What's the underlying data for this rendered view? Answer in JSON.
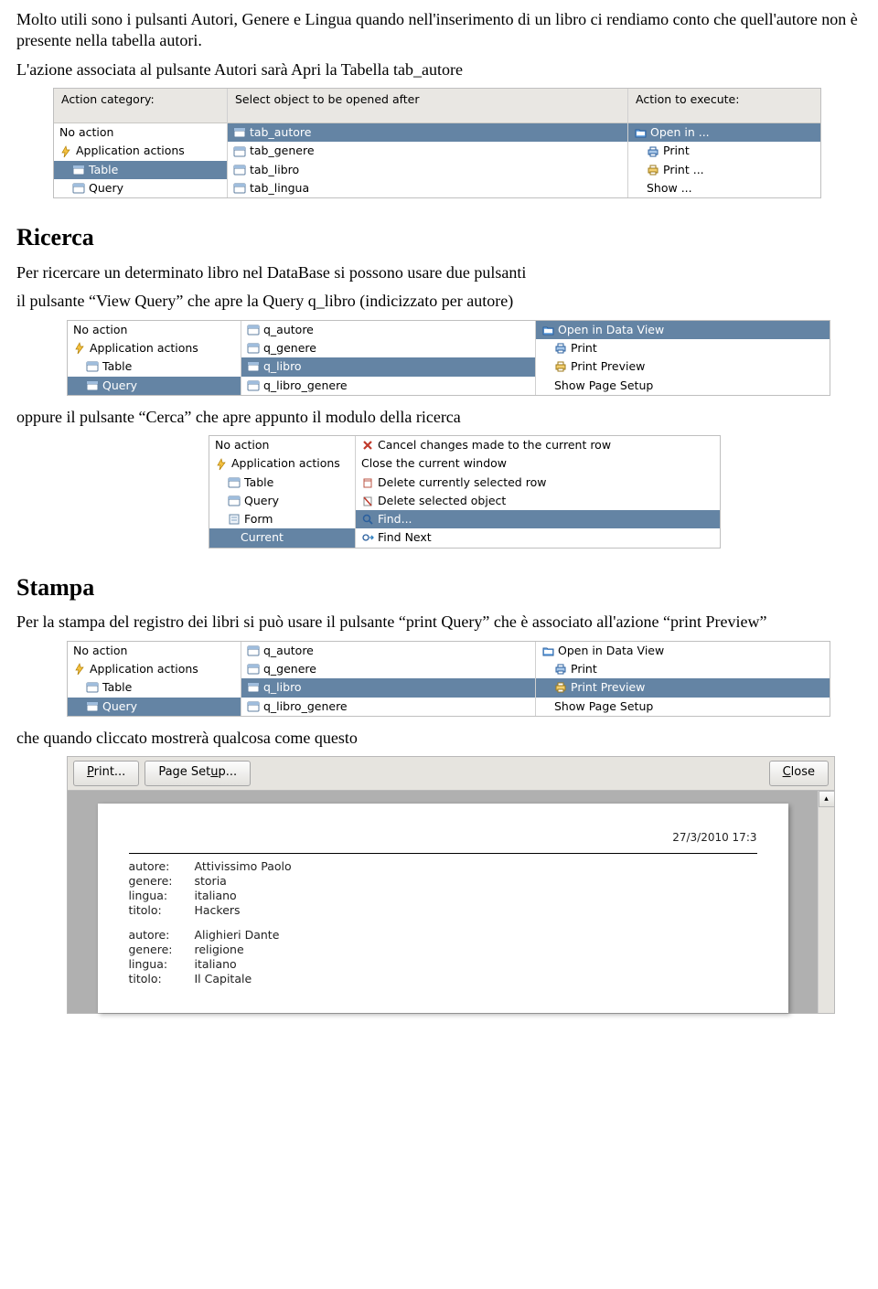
{
  "intro": {
    "p1": "Molto utili sono i pulsanti Autori, Genere e Lingua quando nell'inserimento di un libro ci rendiamo conto che quell'autore non è presente nella tabella autori.",
    "p2": "L'azione associata al pulsante Autori sarà Apri la Tabella tab_autore"
  },
  "panel1": {
    "headers": {
      "col1": "Action category:",
      "col2": "Select object to be opened after",
      "col3": "Action to execute:"
    },
    "col1": [
      {
        "label": "No action",
        "icon": "",
        "sel": false
      },
      {
        "label": "Application actions",
        "icon": "lightning",
        "sel": false
      },
      {
        "label": "Table",
        "icon": "table",
        "sel": true,
        "indent": true
      },
      {
        "label": "Query",
        "icon": "table",
        "sel": false,
        "indent": true
      }
    ],
    "col2": [
      {
        "label": "tab_autore",
        "icon": "table",
        "sel": true
      },
      {
        "label": "tab_genere",
        "icon": "table",
        "sel": false
      },
      {
        "label": "tab_libro",
        "icon": "table",
        "sel": false
      },
      {
        "label": "tab_lingua",
        "icon": "table",
        "sel": false
      }
    ],
    "col3": [
      {
        "label": "Open in ...",
        "icon": "folder",
        "sel": true
      },
      {
        "label": "Print",
        "icon": "printer",
        "sel": false,
        "indent": true
      },
      {
        "label": "Print ...",
        "icon": "printer-y",
        "sel": false,
        "indent": true
      },
      {
        "label": "Show ...",
        "icon": "",
        "sel": false,
        "indent": true
      }
    ]
  },
  "ricerca": {
    "heading": "Ricerca",
    "p1": "Per ricercare un determinato libro nel DataBase si possono usare due pulsanti",
    "p2": "il pulsante “View Query” che apre la Query q_libro (indicizzato per autore)",
    "p3": "oppure il pulsante “Cerca” che apre appunto il modulo della ricerca"
  },
  "panel2": {
    "col1": [
      {
        "label": "No action",
        "icon": "",
        "sel": false
      },
      {
        "label": "Application actions",
        "icon": "lightning",
        "sel": false
      },
      {
        "label": "Table",
        "icon": "table",
        "sel": false,
        "indent": true
      },
      {
        "label": "Query",
        "icon": "table",
        "sel": true,
        "indent": true
      }
    ],
    "col2": [
      {
        "label": "q_autore",
        "icon": "table",
        "sel": false
      },
      {
        "label": "q_genere",
        "icon": "table",
        "sel": false
      },
      {
        "label": "q_libro",
        "icon": "table",
        "sel": true
      },
      {
        "label": "q_libro_genere",
        "icon": "table",
        "sel": false
      }
    ],
    "col3": [
      {
        "label": "Open in Data View",
        "icon": "folder",
        "sel": true
      },
      {
        "label": "Print",
        "icon": "printer",
        "sel": false,
        "indent": true
      },
      {
        "label": "Print Preview",
        "icon": "printer-y",
        "sel": false,
        "indent": true
      },
      {
        "label": "Show Page Setup",
        "icon": "",
        "sel": false,
        "indent": true
      }
    ]
  },
  "panel3": {
    "col1": [
      {
        "label": "No action",
        "icon": "",
        "sel": false
      },
      {
        "label": "Application actions",
        "icon": "lightning",
        "sel": false
      },
      {
        "label": "Table",
        "icon": "table",
        "sel": false,
        "indent": true
      },
      {
        "label": "Query",
        "icon": "table",
        "sel": false,
        "indent": true
      },
      {
        "label": "Form",
        "icon": "form",
        "sel": false,
        "indent": true
      },
      {
        "label": "Current",
        "icon": "",
        "sel": true,
        "indent": true,
        "indent2": true
      }
    ],
    "col2": [
      {
        "label": "Cancel changes made to the current row",
        "icon": "cancel",
        "sel": false
      },
      {
        "label": "Close the current window",
        "icon": "",
        "sel": false
      },
      {
        "label": "Delete currently selected row",
        "icon": "delete",
        "sel": false
      },
      {
        "label": "Delete selected object",
        "icon": "delete2",
        "sel": false
      },
      {
        "label": "Find...",
        "icon": "find",
        "sel": true
      },
      {
        "label": "Find Next",
        "icon": "findnext",
        "sel": false
      }
    ]
  },
  "stampa": {
    "heading": "Stampa",
    "p1": "Per la stampa del registro dei libri si può usare il pulsante “print Query” che è associato all'azione “print Preview”",
    "p2": "che quando cliccato mostrerà qualcosa come questo"
  },
  "panel4": {
    "col1": [
      {
        "label": "No action",
        "icon": "",
        "sel": false
      },
      {
        "label": "Application actions",
        "icon": "lightning",
        "sel": false
      },
      {
        "label": "Table",
        "icon": "table",
        "sel": false,
        "indent": true
      },
      {
        "label": "Query",
        "icon": "table",
        "sel": true,
        "indent": true
      }
    ],
    "col2": [
      {
        "label": "q_autore",
        "icon": "table",
        "sel": false
      },
      {
        "label": "q_genere",
        "icon": "table",
        "sel": false
      },
      {
        "label": "q_libro",
        "icon": "table",
        "sel": true
      },
      {
        "label": "q_libro_genere",
        "icon": "table",
        "sel": false
      }
    ],
    "col3": [
      {
        "label": "Open in Data View",
        "icon": "folder",
        "sel": false
      },
      {
        "label": "Print",
        "icon": "printer",
        "sel": false,
        "indent": true
      },
      {
        "label": "Print Preview",
        "icon": "printer-y",
        "sel": true,
        "indent": true
      },
      {
        "label": "Show Page Setup",
        "icon": "",
        "sel": false,
        "indent": true
      }
    ]
  },
  "preview": {
    "buttons": {
      "print": "Print...",
      "setup": "Page Setup...",
      "close": "Close"
    },
    "date": "27/3/2010 17:3",
    "records": [
      {
        "autore": "Attivissimo Paolo",
        "genere": "storia",
        "lingua": "italiano",
        "titolo": "Hackers"
      },
      {
        "autore": "Alighieri Dante",
        "genere": "religione",
        "lingua": "italiano",
        "titolo": "Il Capitale"
      }
    ],
    "labels": {
      "autore": "autore:",
      "genere": "genere:",
      "lingua": "lingua:",
      "titolo": "titolo:"
    }
  }
}
